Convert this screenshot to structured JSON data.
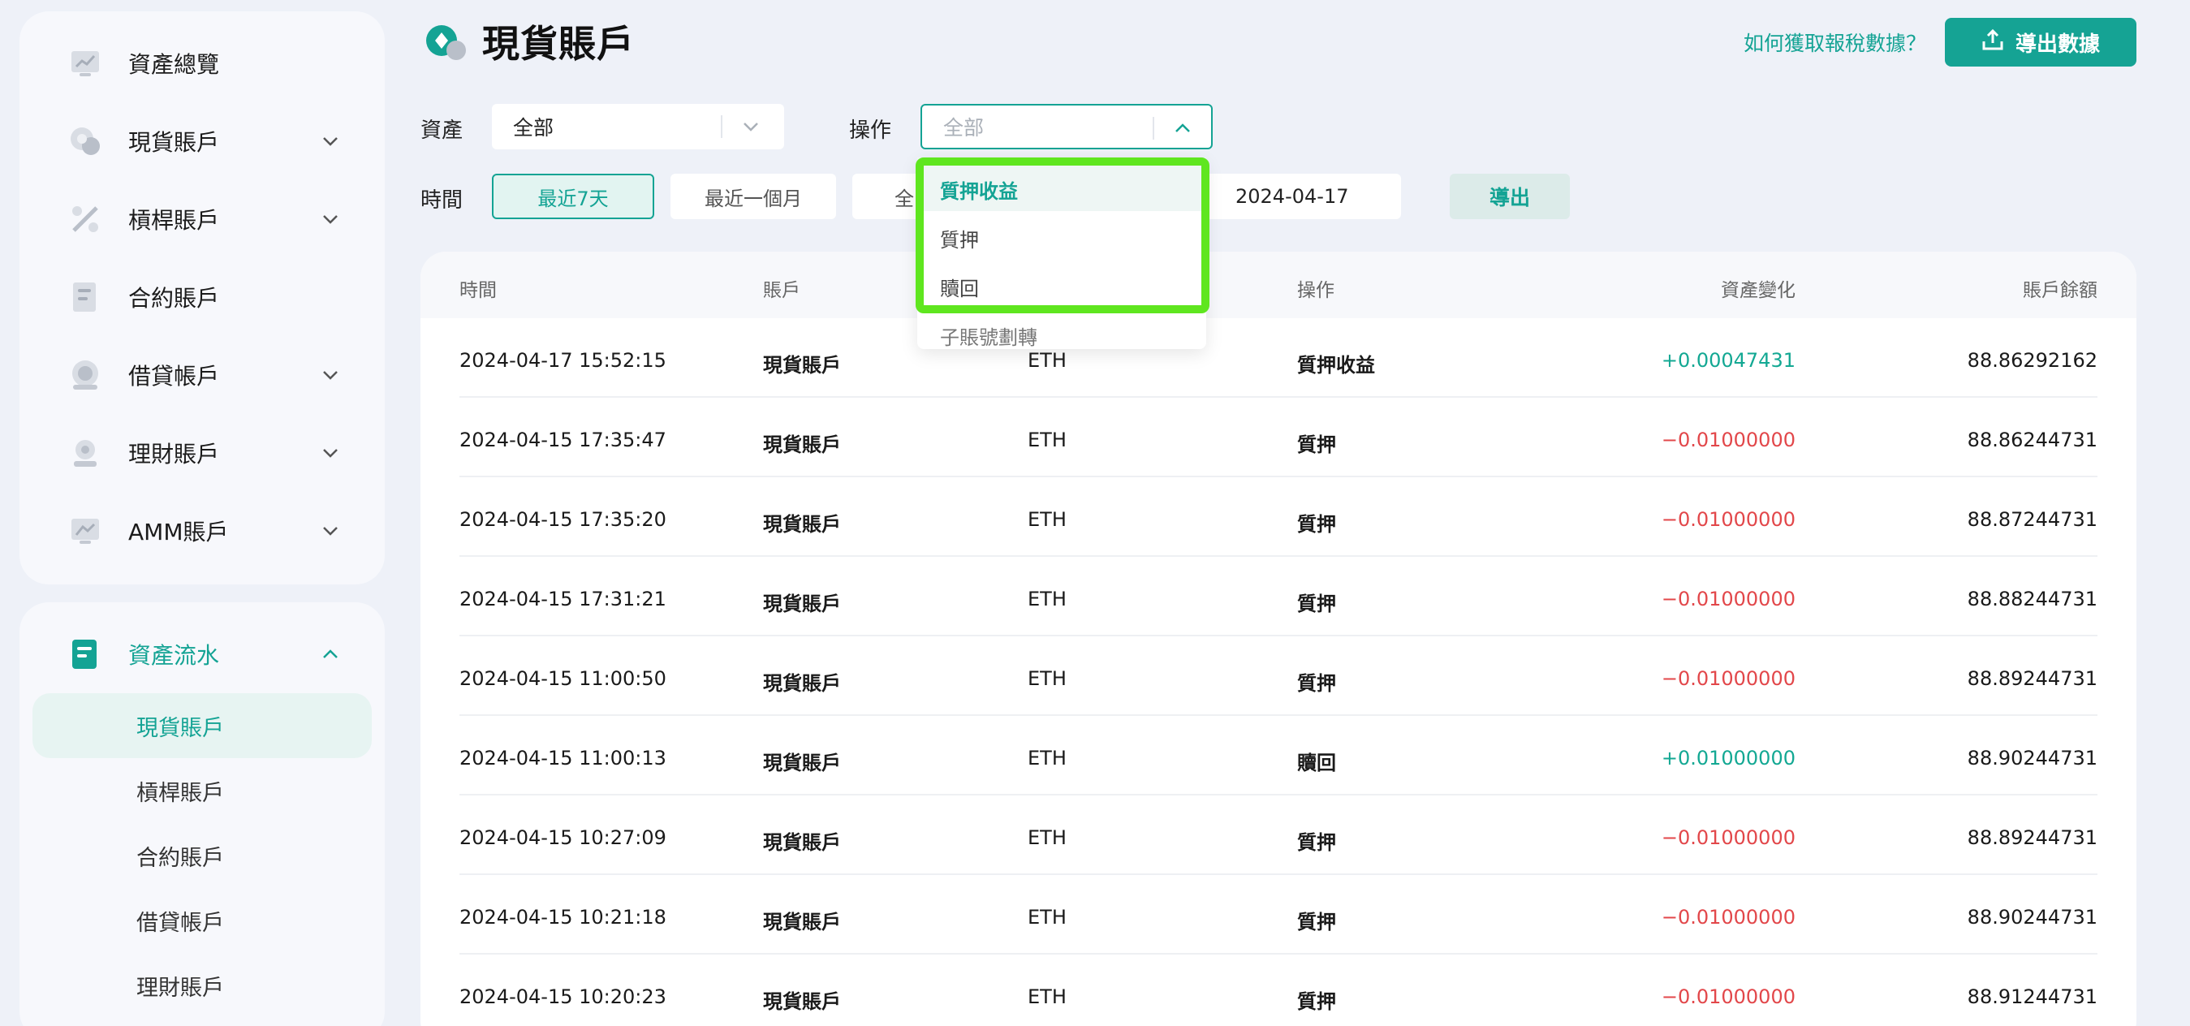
{
  "sidebar": {
    "top_items": [
      {
        "label": "資產總覽",
        "icon": "chart-board-icon",
        "has_chevron": false
      },
      {
        "label": "現貨賬戶",
        "icon": "coins-icon",
        "has_chevron": true
      },
      {
        "label": "槓桿賬戶",
        "icon": "percent-tools-icon",
        "has_chevron": true
      },
      {
        "label": "合約賬戶",
        "icon": "document-icon",
        "has_chevron": false
      },
      {
        "label": "借貸帳戶",
        "icon": "coin-stack-icon",
        "has_chevron": true
      },
      {
        "label": "理財賬戶",
        "icon": "savings-icon",
        "has_chevron": true
      },
      {
        "label": "AMM賬戶",
        "icon": "amm-chart-icon",
        "has_chevron": true
      }
    ],
    "flow_section": {
      "label": "資產流水",
      "icon": "ledger-icon",
      "expanded": true,
      "sub_items": [
        {
          "label": "現貨賬戶",
          "active": true
        },
        {
          "label": "槓桿賬戶",
          "active": false
        },
        {
          "label": "合約賬戶",
          "active": false
        },
        {
          "label": "借貸帳戶",
          "active": false
        },
        {
          "label": "理財賬戶",
          "active": false
        }
      ]
    }
  },
  "header": {
    "title": "現貨賬戶",
    "tax_link": "如何獲取報稅數據？",
    "export_label": "導出數據"
  },
  "filters": {
    "asset_label": "資產",
    "asset_value": "全部",
    "operation_label": "操作",
    "operation_placeholder": "全部",
    "time_label": "時間",
    "time_options": [
      "最近7天",
      "最近一個月",
      "全"
    ],
    "active_time": "最近7天",
    "end_date": "2024-04-17",
    "export_button": "導出"
  },
  "dropdown": {
    "options": [
      "質押收益",
      "質押",
      "贖回",
      "子賬號劃轉"
    ],
    "selected": "質押收益"
  },
  "table": {
    "columns": [
      "時間",
      "賬戶",
      "",
      "操作",
      "資產變化",
      "賬戶餘額"
    ],
    "rows": [
      {
        "time": "2024-04-17 15:52:15",
        "account": "現貨賬戶",
        "asset": "ETH",
        "operation": "質押收益",
        "change": "+0.00047431",
        "balance": "88.86292162"
      },
      {
        "time": "2024-04-15 17:35:47",
        "account": "現貨賬戶",
        "asset": "ETH",
        "operation": "質押",
        "change": "−0.01000000",
        "balance": "88.86244731"
      },
      {
        "time": "2024-04-15 17:35:20",
        "account": "現貨賬戶",
        "asset": "ETH",
        "operation": "質押",
        "change": "−0.01000000",
        "balance": "88.87244731"
      },
      {
        "time": "2024-04-15 17:31:21",
        "account": "現貨賬戶",
        "asset": "ETH",
        "operation": "質押",
        "change": "−0.01000000",
        "balance": "88.88244731"
      },
      {
        "time": "2024-04-15 11:00:50",
        "account": "現貨賬戶",
        "asset": "ETH",
        "operation": "質押",
        "change": "−0.01000000",
        "balance": "88.89244731"
      },
      {
        "time": "2024-04-15 11:00:13",
        "account": "現貨賬戶",
        "asset": "ETH",
        "operation": "贖回",
        "change": "+0.01000000",
        "balance": "88.90244731"
      },
      {
        "time": "2024-04-15 10:27:09",
        "account": "現貨賬戶",
        "asset": "ETH",
        "operation": "質押",
        "change": "−0.01000000",
        "balance": "88.89244731"
      },
      {
        "time": "2024-04-15 10:21:18",
        "account": "現貨賬戶",
        "asset": "ETH",
        "operation": "質押",
        "change": "−0.01000000",
        "balance": "88.90244731"
      },
      {
        "time": "2024-04-15 10:20:23",
        "account": "現貨賬戶",
        "asset": "ETH",
        "operation": "質押",
        "change": "−0.01000000",
        "balance": "88.91244731"
      }
    ]
  },
  "colors": {
    "accent": "#14a394",
    "positive": "#13a893",
    "negative": "#e2474a",
    "highlight": "#5fe61f"
  }
}
